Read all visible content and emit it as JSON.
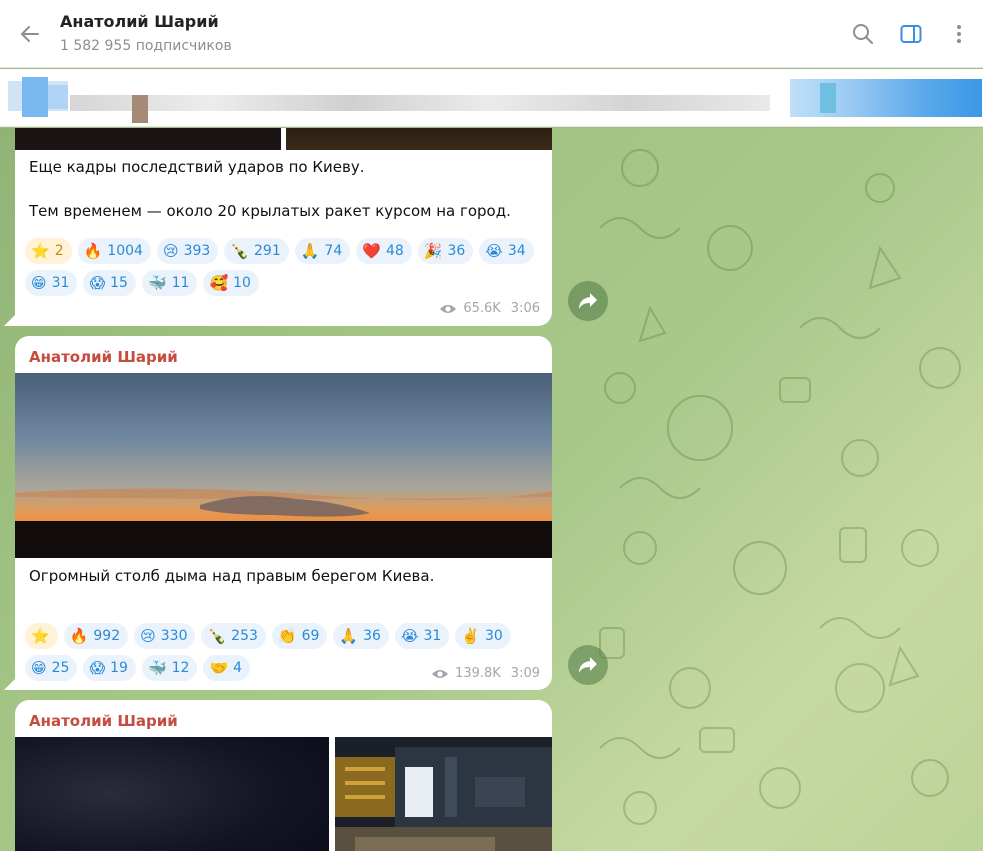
{
  "header": {
    "title": "Анатолий Шарий",
    "subscribers": "1 582 955 подписчиков",
    "back_icon": "arrow-left-icon",
    "search_icon": "search-icon",
    "sidebar_icon": "sidebar-toggle-icon",
    "menu_icon": "kebab-menu-icon"
  },
  "colors": {
    "author": "#c44d3f",
    "reaction_text": "#2b8ad6",
    "reaction_bg": "#eaf3fb",
    "wallpaper": "#a3c485"
  },
  "messages": [
    {
      "text": "Еще кадры последствий ударов по Киеву.\n\nТем временем — около 20 крылатых ракет курсом на город.",
      "reactions": [
        {
          "emoji": "⭐",
          "count": "2"
        },
        {
          "emoji": "🔥",
          "count": "1004"
        },
        {
          "emoji": "😢",
          "count": "393"
        },
        {
          "emoji": "🍾",
          "count": "291"
        },
        {
          "emoji": "🙏",
          "count": "74"
        },
        {
          "emoji": "❤️",
          "count": "48"
        },
        {
          "emoji": "🎉",
          "count": "36"
        },
        {
          "emoji": "😭",
          "count": "34"
        },
        {
          "emoji": "😁",
          "count": "31"
        },
        {
          "emoji": "😱",
          "count": "15"
        },
        {
          "emoji": "🐳",
          "count": "11"
        },
        {
          "emoji": "🥰",
          "count": "10"
        }
      ],
      "views": "65.6K",
      "time": "3:06"
    },
    {
      "author": "Анатолий Шарий",
      "text": "Огромный столб дыма над правым берегом Киева.",
      "reactions": [
        {
          "emoji": "⭐",
          "count": ""
        },
        {
          "emoji": "🔥",
          "count": "992"
        },
        {
          "emoji": "😢",
          "count": "330"
        },
        {
          "emoji": "🍾",
          "count": "253"
        },
        {
          "emoji": "👏",
          "count": "69"
        },
        {
          "emoji": "🙏",
          "count": "36"
        },
        {
          "emoji": "😭",
          "count": "31"
        },
        {
          "emoji": "✌️",
          "count": "30"
        },
        {
          "emoji": "😁",
          "count": "25"
        },
        {
          "emoji": "😱",
          "count": "19"
        },
        {
          "emoji": "🐳",
          "count": "12"
        },
        {
          "emoji": "🤝",
          "count": "4"
        }
      ],
      "views": "139.8K",
      "time": "3:09"
    },
    {
      "author": "Анатолий Шарий"
    }
  ]
}
